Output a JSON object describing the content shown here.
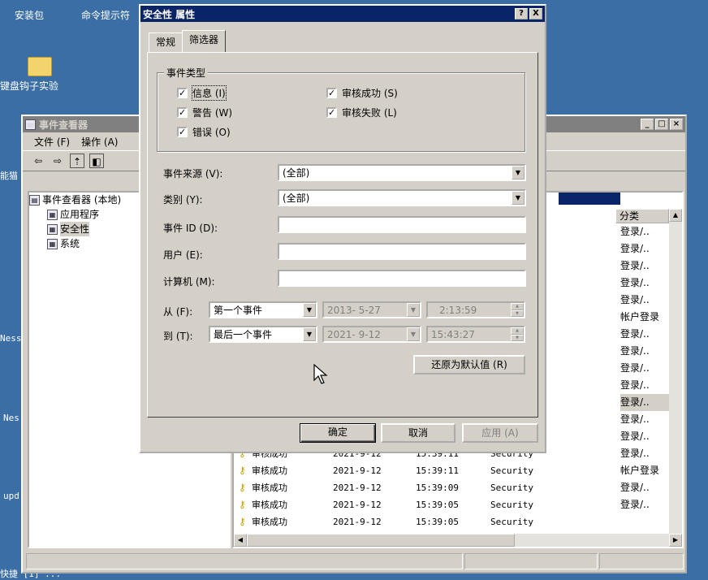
{
  "desktop": {
    "icons": [
      "安装包",
      "命令提示符",
      "键盘钩子实验"
    ],
    "side_texts": [
      "能猫",
      "Ness",
      "Nes",
      "upd"
    ],
    "bottom_text": "快捷 [1]  ..."
  },
  "event_viewer": {
    "title": "事件查看器",
    "menu": [
      "文件 (F)",
      "操作 (A)"
    ],
    "tree": {
      "root": "事件查看器 (本地)",
      "children": [
        "应用程序",
        "安全性",
        "系统"
      ]
    },
    "columns": {
      "category": "分类"
    },
    "categories": [
      "登录/..",
      "登录/..",
      "登录/..",
      "登录/..",
      "登录/..",
      "帐户登录",
      "登录/..",
      "登录/..",
      "登录/..",
      "登录/..",
      "登录/..",
      "登录/..",
      "登录/..",
      "登录/..",
      "帐户登录",
      "登录/..",
      "登录/.."
    ],
    "rows": [
      {
        "type": "审核成功",
        "date": "2021-9-12",
        "time": "15:39:11",
        "source": "Security"
      },
      {
        "type": "审核成功",
        "date": "2021-9-12",
        "time": "15:39:11",
        "source": "Security"
      },
      {
        "type": "审核成功",
        "date": "2021-9-12",
        "time": "15:39:09",
        "source": "Security"
      },
      {
        "type": "审核成功",
        "date": "2021-9-12",
        "time": "15:39:05",
        "source": "Security"
      },
      {
        "type": "审核成功",
        "date": "2021-9-12",
        "time": "15:39:05",
        "source": "Security"
      }
    ]
  },
  "dialog": {
    "title": "安全性 属性",
    "tabs": [
      "常规",
      "筛选器"
    ],
    "event_types_label": "事件类型",
    "checks": {
      "info": "信息 (I)",
      "warning": "警告 (W)",
      "error": "错误 (O)",
      "audit_success": "审核成功 (S)",
      "audit_failure": "审核失败 (L)"
    },
    "check_mark": "✓",
    "fields": {
      "source_label": "事件来源 (V):",
      "source_value": "(全部)",
      "category_label": "类别 (Y):",
      "category_value": "(全部)",
      "event_id_label": "事件 ID (D):",
      "user_label": "用户 (E):",
      "computer_label": "计算机 (M):"
    },
    "from": {
      "label": "从 (F):",
      "value": "第一个事件",
      "date": "2013- 5-27",
      "time": "2:13:59"
    },
    "to": {
      "label": "到 (T):",
      "value": "最后一个事件",
      "date": "2021- 9-12",
      "time": "15:43:27"
    },
    "restore_defaults": "还原为默认值 (R)",
    "ok": "确定",
    "cancel": "取消",
    "apply": "应用 (A)",
    "help_btn": "?",
    "close_btn": "X"
  }
}
